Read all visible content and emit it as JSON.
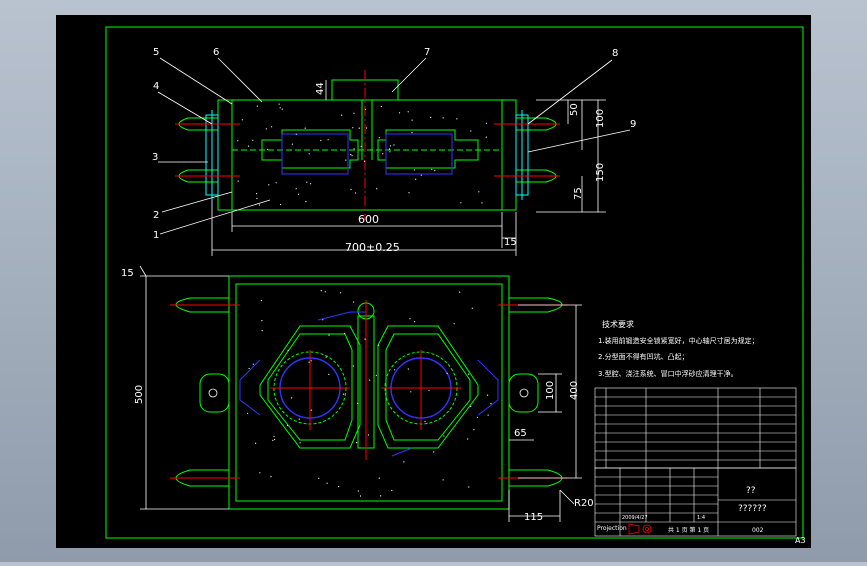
{
  "colors": {
    "background_outer": "#a9b4c2",
    "canvas": "#000000",
    "frame": "#00ff00",
    "outline": "#00ff00",
    "hidden": "#3333ff",
    "centerline": "#ff0000",
    "dim": "#ffffff",
    "leader": "#ffffff",
    "pin": "#00ffff"
  },
  "balloons": [
    "5",
    "6",
    "7",
    "8",
    "4",
    "3",
    "9",
    "2",
    "1"
  ],
  "dimensions": {
    "top_44": "44",
    "top_50": "50",
    "top_100": "100",
    "top_150": "150",
    "top_75": "75",
    "top_600": "600",
    "top_15": "15",
    "top_700": "700±0.25",
    "plan_15": "15",
    "plan_500": "500",
    "plan_400": "400",
    "plan_100": "100",
    "plan_65": "65",
    "plan_115": "115",
    "plan_r20": "R20"
  },
  "notes": {
    "title": "技术要求",
    "line1": "1.装用前锻造安全锁紧宽好，中心轴尺寸居为规定；",
    "line2": "2.分型面不得有凹坑、凸起；",
    "line3": "3.型腔、浇注系统、冒口中浮砂应清理干净。"
  },
  "title_block": {
    "qq": "??",
    "drawing_name": "??????",
    "scale": "1:4",
    "date": "2009/4/27",
    "sheet": "共 1 页 第 1 页",
    "code": "002",
    "projection": "Projection",
    "sheet_size": "A3"
  }
}
